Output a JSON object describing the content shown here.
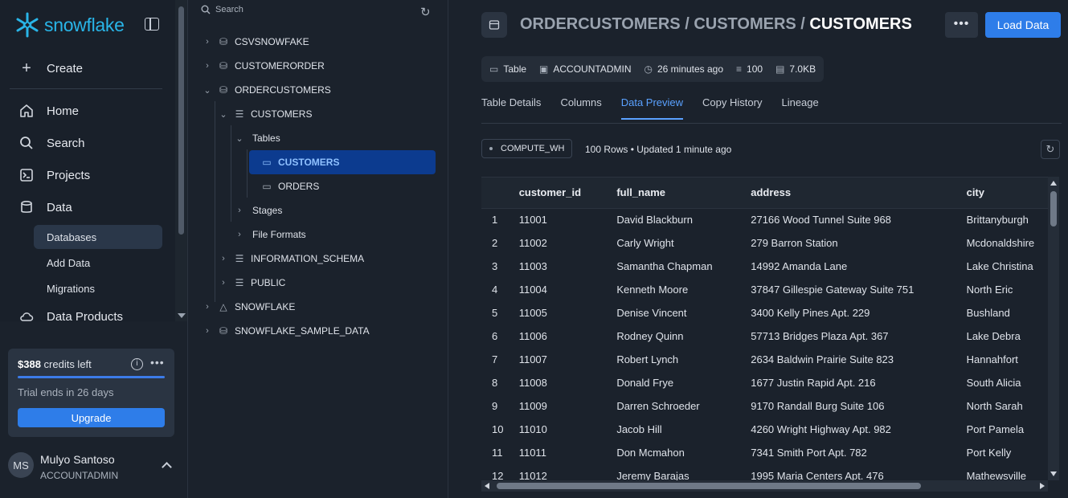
{
  "app": {
    "logo_text": "snowflake",
    "brand_color": "#29b5e8",
    "accent_color": "#2e7de9"
  },
  "nav": {
    "create": "Create",
    "items": [
      {
        "label": "Home",
        "icon": "home-icon"
      },
      {
        "label": "Search",
        "icon": "search-icon"
      },
      {
        "label": "Projects",
        "icon": "terminal-icon"
      },
      {
        "label": "Data",
        "icon": "database-icon"
      }
    ],
    "data_sub": [
      "Databases",
      "Add Data",
      "Migrations"
    ],
    "data_products": "Data Products"
  },
  "credits": {
    "amount": "$388",
    "suffix": " credits left",
    "trial": "Trial ends in 26 days",
    "upgrade": "Upgrade"
  },
  "user": {
    "initials": "MS",
    "name": "Mulyo Santoso",
    "role": "ACCOUNTADMIN"
  },
  "tree": {
    "search_placeholder": "Search",
    "rows": {
      "csvsnowfake": "CSVSNOWFAKE",
      "customerorder": "CUSTOMERORDER",
      "ordercustomers": "ORDERCUSTOMERS",
      "schema_customers": "CUSTOMERS",
      "tables": "Tables",
      "table_customers": "CUSTOMERS",
      "table_orders": "ORDERS",
      "stages": "Stages",
      "file_formats": "File Formats",
      "information_schema": "INFORMATION_SCHEMA",
      "public": "PUBLIC",
      "snowflake": "SNOWFLAKE",
      "snowflake_sample_data": "SNOWFLAKE_SAMPLE_DATA"
    }
  },
  "header": {
    "crumb_db": "ORDERCUSTOMERS",
    "crumb_sep": " / ",
    "crumb_schema": "CUSTOMERS",
    "crumb_table": "CUSTOMERS",
    "load_data": "Load Data"
  },
  "meta": {
    "type": "Table",
    "owner": "ACCOUNTADMIN",
    "updated": "26 minutes ago",
    "rows": "100",
    "size": "7.0KB"
  },
  "tabs": [
    "Table Details",
    "Columns",
    "Data Preview",
    "Copy History",
    "Lineage"
  ],
  "active_tab": "Data Preview",
  "preview": {
    "warehouse": "COMPUTE_WH",
    "rows_info": "100 Rows • Updated 1 minute ago",
    "columns": [
      "",
      "customer_id",
      "full_name",
      "address",
      "city"
    ],
    "rows": [
      [
        "1",
        "11001",
        "David Blackburn",
        "27166 Wood Tunnel Suite 968",
        "Brittanyburgh"
      ],
      [
        "2",
        "11002",
        "Carly Wright",
        "279 Barron Station",
        "Mcdonaldshire"
      ],
      [
        "3",
        "11003",
        "Samantha Chapman",
        "14992 Amanda Lane",
        "Lake Christina"
      ],
      [
        "4",
        "11004",
        "Kenneth Moore",
        "37847 Gillespie Gateway Suite 751",
        "North Eric"
      ],
      [
        "5",
        "11005",
        "Denise Vincent",
        "3400 Kelly Pines Apt. 229",
        "Bushland"
      ],
      [
        "6",
        "11006",
        "Rodney Quinn",
        "57713 Bridges Plaza Apt. 367",
        "Lake Debra"
      ],
      [
        "7",
        "11007",
        "Robert Lynch",
        "2634 Baldwin Prairie Suite 823",
        "Hannahfort"
      ],
      [
        "8",
        "11008",
        "Donald Frye",
        "1677 Justin Rapid Apt. 216",
        "South Alicia"
      ],
      [
        "9",
        "11009",
        "Darren Schroeder",
        "9170 Randall Burg Suite 106",
        "North Sarah"
      ],
      [
        "10",
        "11010",
        "Jacob Hill",
        "4260 Wright Highway Apt. 982",
        "Port Pamela"
      ],
      [
        "11",
        "11011",
        "Don Mcmahon",
        "7341 Smith Port Apt. 782",
        "Port Kelly"
      ],
      [
        "12",
        "11012",
        "Jeremy Barajas",
        "1995 Maria Centers Apt. 476",
        "Mathewsville"
      ]
    ]
  }
}
